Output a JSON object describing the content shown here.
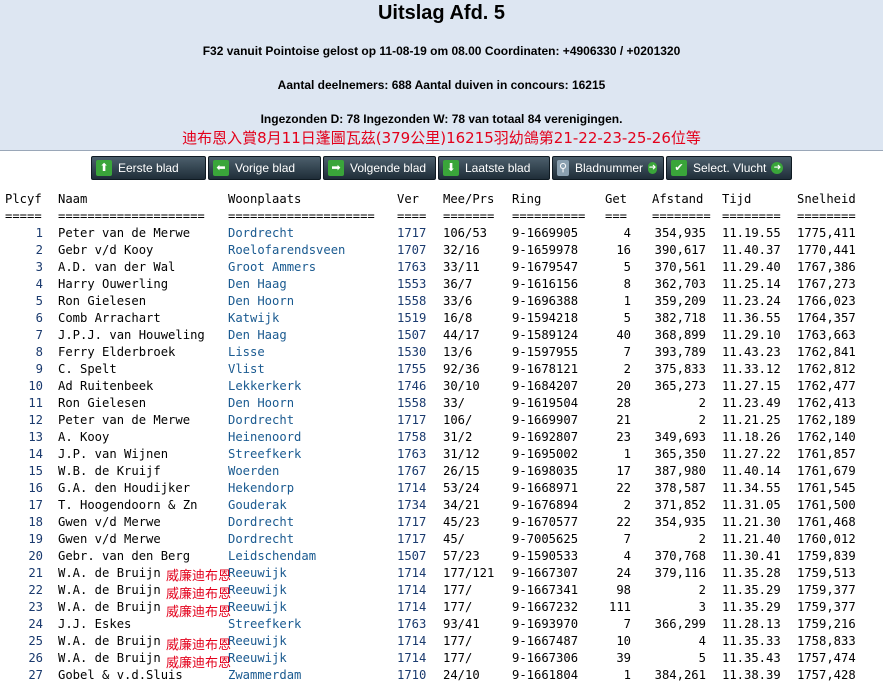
{
  "header": {
    "title": "Uitslag Afd. 5",
    "line1": "F32 vanuit Pointoise gelost op 11-08-19 om 08.00 Coordinaten: +4906330 / +0201320",
    "line2": "Aantal deelnemers: 688 Aantal duiven in concours: 16215",
    "line3": "Ingezonden D: 78 Ingezonden W: 78 van totaal 84 verenigingen.",
    "red_note": "迪布恩入賞8月11日蓬圖瓦茲(379公里)16215羽幼鴿第21-22-23-25-26位等"
  },
  "nav": [
    {
      "label": "Eerste blad",
      "icon": "arrow-up-icon"
    },
    {
      "label": "Vorige blad",
      "icon": "arrow-left-icon"
    },
    {
      "label": "Volgende blad",
      "icon": "arrow-right-icon"
    },
    {
      "label": "Laatste blad",
      "icon": "arrow-down-icon"
    },
    {
      "label": "Bladnummer",
      "icon": "search-icon"
    },
    {
      "label": "Select. Vlucht",
      "icon": "check-icon"
    }
  ],
  "columns": [
    "Plcyf",
    "Naam",
    "Woonplaats",
    "Ver",
    "Mee/Prs",
    "Ring",
    "Get",
    "Afstand",
    "Tijd",
    "Snelheid"
  ],
  "separators": [
    "=====",
    "====================",
    "====================",
    "====",
    "=======",
    "==========",
    "===",
    "========",
    "========",
    "========"
  ],
  "rows": [
    [
      "1",
      "Peter van de Merwe",
      "Dordrecht",
      "1717",
      "106/53",
      "9-1669905",
      "4",
      "354,935",
      "11.19.55",
      "1775,411"
    ],
    [
      "2",
      "Gebr v/d Kooy",
      "Roelofarendsveen",
      "1707",
      "32/16",
      "9-1659978",
      "16",
      "390,617",
      "11.40.37",
      "1770,441"
    ],
    [
      "3",
      "A.D. van der Wal",
      "Groot Ammers",
      "1763",
      "33/11",
      "9-1679547",
      "5",
      "370,561",
      "11.29.40",
      "1767,386"
    ],
    [
      "4",
      "Harry Ouwerling",
      "Den Haag",
      "1553",
      "36/7",
      "9-1616156",
      "8",
      "362,703",
      "11.25.14",
      "1767,273"
    ],
    [
      "5",
      "Ron Gielesen",
      "Den Hoorn",
      "1558",
      "33/6",
      "9-1696388",
      "1",
      "359,209",
      "11.23.24",
      "1766,023"
    ],
    [
      "6",
      "Comb Arrachart",
      "Katwijk",
      "1519",
      "16/8",
      "9-1594218",
      "5",
      "382,718",
      "11.36.55",
      "1764,357"
    ],
    [
      "7",
      "J.P.J. van Houweling",
      "Den Haag",
      "1507",
      "44/17",
      "9-1589124",
      "40",
      "368,899",
      "11.29.10",
      "1763,663"
    ],
    [
      "8",
      "Ferry Elderbroek",
      "Lisse",
      "1530",
      "13/6",
      "9-1597955",
      "7",
      "393,789",
      "11.43.23",
      "1762,841"
    ],
    [
      "9",
      "C. Spelt",
      "Vlist",
      "1755",
      "92/36",
      "9-1678121",
      "2",
      "375,833",
      "11.33.12",
      "1762,812"
    ],
    [
      "10",
      "Ad Ruitenbeek",
      "Lekkerkerk",
      "1746",
      "30/10",
      "9-1684207",
      "20",
      "365,273",
      "11.27.15",
      "1762,477"
    ],
    [
      "11",
      "Ron Gielesen",
      "Den Hoorn",
      "1558",
      "33/",
      "9-1619504",
      "28",
      "2",
      "11.23.49",
      "1762,413"
    ],
    [
      "12",
      "Peter van de Merwe",
      "Dordrecht",
      "1717",
      "106/",
      "9-1669907",
      "21",
      "2",
      "11.21.25",
      "1762,189"
    ],
    [
      "13",
      "A. Kooy",
      "Heinenoord",
      "1758",
      "31/2",
      "9-1692807",
      "23",
      "349,693",
      "11.18.26",
      "1762,140"
    ],
    [
      "14",
      "J.P. van Wijnen",
      "Streefkerk",
      "1763",
      "31/12",
      "9-1695002",
      "1",
      "365,350",
      "11.27.22",
      "1761,857"
    ],
    [
      "15",
      "W.B. de Kruijf",
      "Woerden",
      "1767",
      "26/15",
      "9-1698035",
      "17",
      "387,980",
      "11.40.14",
      "1761,679"
    ],
    [
      "16",
      "G.A. den Houdijker",
      "Hekendorp",
      "1714",
      "53/24",
      "9-1668971",
      "22",
      "378,587",
      "11.34.55",
      "1761,545"
    ],
    [
      "17",
      "T. Hoogendoorn & Zn",
      "Gouderak",
      "1734",
      "34/21",
      "9-1676894",
      "2",
      "371,852",
      "11.31.05",
      "1761,500"
    ],
    [
      "18",
      "Gwen v/d Merwe",
      "Dordrecht",
      "1717",
      "45/23",
      "9-1670577",
      "22",
      "354,935",
      "11.21.30",
      "1761,468"
    ],
    [
      "19",
      "Gwen v/d Merwe",
      "Dordrecht",
      "1717",
      "45/",
      "9-7005625",
      "7",
      "2",
      "11.21.40",
      "1760,012"
    ],
    [
      "20",
      "Gebr. van den Berg",
      "Leidschendam",
      "1507",
      "57/23",
      "9-1590533",
      "4",
      "370,768",
      "11.30.41",
      "1759,839"
    ],
    [
      "21",
      "W.A. de Bruijn",
      "Reeuwijk",
      "1714",
      "177/121",
      "9-1667307",
      "24",
      "379,116",
      "11.35.28",
      "1759,513"
    ],
    [
      "22",
      "W.A. de Bruijn",
      "Reeuwijk",
      "1714",
      "177/",
      "9-1667341",
      "98",
      "2",
      "11.35.29",
      "1759,377"
    ],
    [
      "23",
      "W.A. de Bruijn",
      "Reeuwijk",
      "1714",
      "177/",
      "9-1667232",
      "111",
      "3",
      "11.35.29",
      "1759,377"
    ],
    [
      "24",
      "J.J. Eskes",
      "Streefkerk",
      "1763",
      "93/41",
      "9-1693970",
      "7",
      "366,299",
      "11.28.13",
      "1759,216"
    ],
    [
      "25",
      "W.A. de Bruijn",
      "Reeuwijk",
      "1714",
      "177/",
      "9-1667487",
      "10",
      "4",
      "11.35.33",
      "1758,833"
    ],
    [
      "26",
      "W.A. de Bruijn",
      "Reeuwijk",
      "1714",
      "177/",
      "9-1667306",
      "39",
      "5",
      "11.35.43",
      "1757,474"
    ],
    [
      "27",
      "Gobel & v.d.Sluis",
      "Zwammerdam",
      "1710",
      "24/10",
      "9-1661804",
      "1",
      "384,261",
      "11.38.39",
      "1757,428"
    ]
  ],
  "overlay_label": "威廉迪布恩",
  "colors": {
    "header_bg": "#dde6f2",
    "link": "#1a5a90",
    "red": "#e3001b",
    "button_bg": "#2b3a45"
  }
}
